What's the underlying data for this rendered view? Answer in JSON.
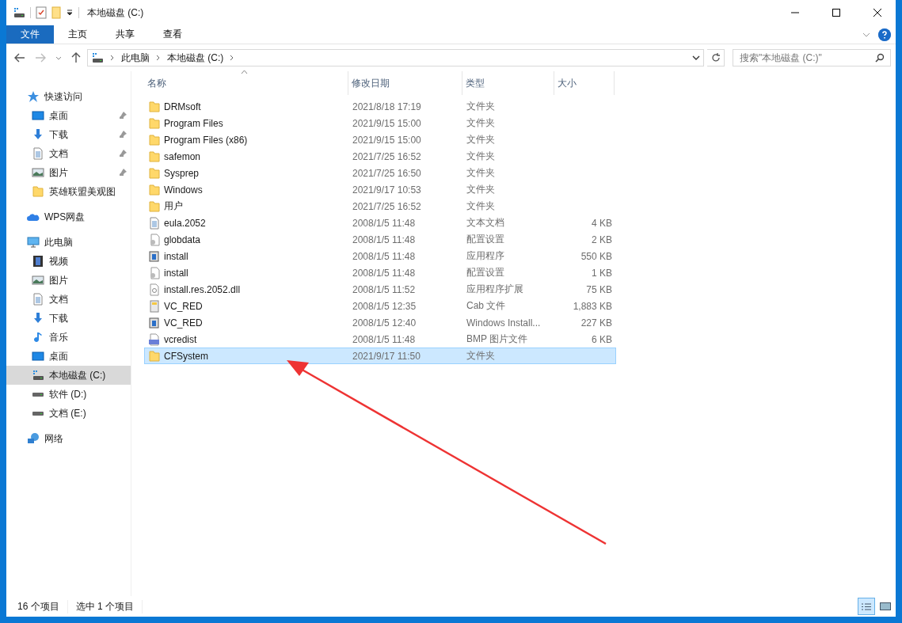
{
  "window": {
    "title": "本地磁盘 (C:)"
  },
  "ribbon_tabs": [
    {
      "label": "文件",
      "selected": true
    },
    {
      "label": "主页",
      "selected": false
    },
    {
      "label": "共享",
      "selected": false
    },
    {
      "label": "查看",
      "selected": false
    }
  ],
  "navigation": {
    "back_disabled": false,
    "forward_disabled": true
  },
  "address_bar": {
    "crumbs": [
      "此电脑",
      "本地磁盘 (C:)"
    ]
  },
  "search": {
    "placeholder": "搜索\"本地磁盘 (C:)\""
  },
  "sidebar": {
    "items": [
      {
        "label": "快速访问",
        "kind": "star",
        "selected": false,
        "children": [
          {
            "label": "桌面",
            "kind": "desktop",
            "selected": false,
            "pinned": true
          },
          {
            "label": "下载",
            "kind": "download",
            "selected": false,
            "pinned": true
          },
          {
            "label": "文档",
            "kind": "document",
            "selected": false,
            "pinned": true
          },
          {
            "label": "图片",
            "kind": "picture",
            "selected": false,
            "pinned": true
          },
          {
            "label": "英雄联盟美观图",
            "kind": "folder",
            "selected": false,
            "pinned": false
          }
        ]
      },
      {
        "label": "WPS网盘",
        "kind": "cloud",
        "selected": false
      },
      {
        "label": "此电脑",
        "kind": "pc",
        "selected": false,
        "children": [
          {
            "label": "视频",
            "kind": "video",
            "selected": false
          },
          {
            "label": "图片",
            "kind": "picture",
            "selected": false
          },
          {
            "label": "文档",
            "kind": "document",
            "selected": false
          },
          {
            "label": "下载",
            "kind": "download",
            "selected": false
          },
          {
            "label": "音乐",
            "kind": "music",
            "selected": false
          },
          {
            "label": "桌面",
            "kind": "desktop",
            "selected": false
          },
          {
            "label": "本地磁盘 (C:)",
            "kind": "system-drive",
            "selected": true
          },
          {
            "label": "软件 (D:)",
            "kind": "drive",
            "selected": false
          },
          {
            "label": "文档 (E:)",
            "kind": "drive",
            "selected": false
          }
        ]
      },
      {
        "label": "网络",
        "kind": "network",
        "selected": false
      }
    ]
  },
  "table": {
    "columns": [
      "名称",
      "修改日期",
      "类型",
      "大小"
    ],
    "rows": [
      {
        "name": "DRMsoft",
        "date": "2021/8/18 17:19",
        "type": "文件夹",
        "kind": "folder",
        "selected": false
      },
      {
        "name": "Program Files",
        "date": "2021/9/15 15:00",
        "type": "文件夹",
        "kind": "folder",
        "selected": false
      },
      {
        "name": "Program Files (x86)",
        "date": "2021/9/15 15:00",
        "type": "文件夹",
        "kind": "folder",
        "selected": false
      },
      {
        "name": "safemon",
        "date": "2021/7/25 16:52",
        "type": "文件夹",
        "kind": "folder",
        "selected": false
      },
      {
        "name": "Sysprep",
        "date": "2021/7/25 16:50",
        "type": "文件夹",
        "kind": "folder",
        "selected": false
      },
      {
        "name": "Windows",
        "date": "2021/9/17 10:53",
        "type": "文件夹",
        "kind": "folder",
        "selected": false
      },
      {
        "name": "用户",
        "date": "2021/7/25 16:52",
        "type": "文件夹",
        "kind": "folder",
        "selected": false
      },
      {
        "name": "eula.2052",
        "date": "2008/1/5 11:48",
        "type": "文本文档",
        "size": "4 KB",
        "kind": "text",
        "selected": false
      },
      {
        "name": "globdata",
        "date": "2008/1/5 11:48",
        "type": "配置设置",
        "size": "2 KB",
        "kind": "config",
        "selected": false
      },
      {
        "name": "install",
        "date": "2008/1/5 11:48",
        "type": "应用程序",
        "size": "550 KB",
        "kind": "app",
        "selected": false
      },
      {
        "name": "install",
        "date": "2008/1/5 11:48",
        "type": "配置设置",
        "size": "1 KB",
        "kind": "config",
        "selected": false
      },
      {
        "name": "install.res.2052.dll",
        "date": "2008/1/5 11:52",
        "type": "应用程序扩展",
        "size": "75 KB",
        "kind": "dll",
        "selected": false
      },
      {
        "name": "VC_RED",
        "date": "2008/1/5 12:35",
        "type": "Cab 文件",
        "size": "1,883 KB",
        "kind": "cab",
        "selected": false
      },
      {
        "name": "VC_RED",
        "date": "2008/1/5 12:40",
        "type": "Windows Install...",
        "size": "227 KB",
        "kind": "app",
        "selected": false
      },
      {
        "name": "vcredist",
        "date": "2008/1/5 11:48",
        "type": "BMP 图片文件",
        "size": "6 KB",
        "kind": "bmp",
        "selected": false
      },
      {
        "name": "CFSystem",
        "date": "2021/9/17 11:50",
        "type": "文件夹",
        "kind": "folder",
        "selected": true
      }
    ]
  },
  "status_bar": {
    "count": "16 个项目",
    "selection": "选中 1 个项目",
    "views": [
      {
        "kind": "details",
        "selected": true
      },
      {
        "kind": "large-icons",
        "selected": false
      }
    ]
  }
}
